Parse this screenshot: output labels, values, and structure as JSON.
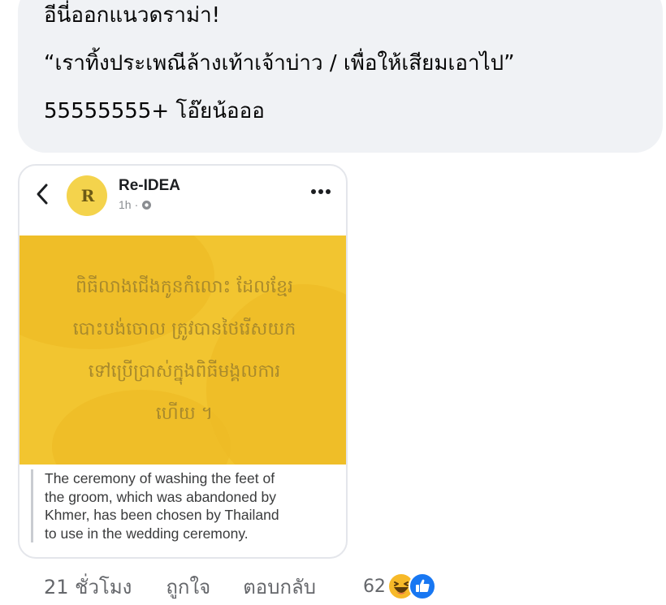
{
  "comment": {
    "lines": [
      "อีนี่ออกแนวดราม่า!",
      "“เราทิ้งประเพณีล้างเท้าเจ้าบ่าว / เพื่อให้เสียมเอาไป”",
      "55555555+ โอ๊ยน้อออ"
    ]
  },
  "shared_post": {
    "page_name": "Re-IDEA",
    "time": "1h",
    "separator": "·",
    "avatar_logo": "R",
    "khmer_lines": [
      "ពិធីលាងជើងកូនកំលោះ ដែលខ្មែរ",
      "បោះបង់ចោល ត្រូវបានថៃរើសយក",
      "ទៅប្រើប្រាស់ក្នុងពិធីមង្គលការ",
      "ហើយ ។"
    ],
    "caption_lines": [
      "The ceremony of washing the feet of",
      "the groom, which was abandoned by",
      "Khmer, has been chosen by Thailand",
      "to use in the wedding ceremony."
    ],
    "block_color": "#f2c530",
    "avatar_color": "#f4d34c"
  },
  "actions": {
    "timestamp": "21 ชั่วโมง",
    "like": "ถูกใจ",
    "reply": "ตอบกลับ",
    "reaction_count": "62",
    "reactions": [
      "haha-icon",
      "like-icon"
    ]
  }
}
